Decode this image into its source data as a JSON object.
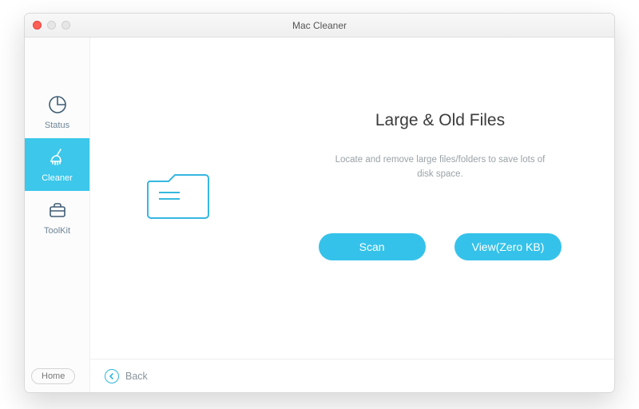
{
  "window": {
    "title": "Mac Cleaner"
  },
  "sidebar": {
    "items": [
      {
        "label": "Status"
      },
      {
        "label": "Cleaner"
      },
      {
        "label": "ToolKit"
      }
    ],
    "home_label": "Home"
  },
  "main": {
    "headline": "Large & Old Files",
    "subline": "Locate and remove large files/folders to save lots of disk space.",
    "scan_label": "Scan",
    "view_label": "View(Zero KB)"
  },
  "footer": {
    "back_label": "Back"
  }
}
